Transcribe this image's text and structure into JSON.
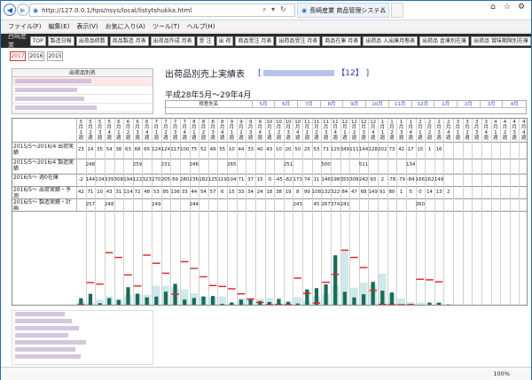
{
  "browser": {
    "url": "http://127.0.0.1/hps/nsys/local/listytshukka.html",
    "tab_title": "長崎産業 商品管理システム",
    "zoom": "100%"
  },
  "menu": [
    "ファイル(F)",
    "編集(E)",
    "表示(V)",
    "お気に入り(A)",
    "ツール(T)",
    "ヘルプ(H)"
  ],
  "app": {
    "brand": "西崎産業",
    "nav": [
      "TOP",
      "製造日報",
      "出荷品修数",
      "商品製造 月表",
      "出荷品作成 月表",
      "受 注",
      "出 荷",
      "商品受注 月表",
      "出荷品受注 月表",
      "商品在庫 月表",
      "出荷品 入出庫月態表",
      "出荷品 倉庫別在庫",
      "出荷品 賞味期限別在庫"
    ]
  },
  "years": [
    "2017",
    "2016",
    "2015"
  ],
  "left_panel": {
    "header": "出荷品別名"
  },
  "report": {
    "title": "出荷品別売上実績表",
    "bracket_open": "[",
    "product_code": "【12】",
    "bracket_close": "]",
    "period": "平成28年5月～29年4月",
    "summary_header": "得意先名",
    "months": [
      "5月",
      "6月",
      "7月",
      "8月",
      "9月",
      "10月",
      "11月",
      "12月",
      "1月",
      "2月",
      "3月",
      "4月"
    ]
  },
  "rows": [
    {
      "label": "2015/5〜2016/4 出荷実績"
    },
    {
      "label": "2015/5〜2016/4 製造実績"
    },
    {
      "label": "2016/5〜 週0在庫"
    },
    {
      "label": "2016/5〜 出荷実績・予測"
    },
    {
      "label": "2016/5〜 製造実績・計画"
    }
  ],
  "weeks": [
    "5月1週",
    "5月2週",
    "5月3週",
    "5月4週",
    "6月1週",
    "6月2週",
    "6月3週",
    "6月4週",
    "7月1週",
    "7月2週",
    "7月3週",
    "7月4週",
    "8月1週",
    "8月2週",
    "8月3週",
    "8月4週",
    "9月1週",
    "9月2週",
    "9月3週",
    "9月4週",
    "10月1週",
    "10月2週",
    "10月3週",
    "10月4週",
    "11月1週",
    "11月2週",
    "11月3週",
    "11月4週",
    "12月1週",
    "12月2週",
    "12月3週",
    "12月4週",
    "1月1週",
    "1月2週",
    "1月3週",
    "1月4週",
    "2月1週",
    "2月2週",
    "2月3週",
    "2月4週",
    "3月1週",
    "3月2週",
    "3月3週",
    "3月4週",
    "4月1週",
    "4月2週",
    "4月3週",
    "4月4週"
  ],
  "data": {
    "ship_prev": [
      "23",
      "14",
      "35",
      "54",
      "38",
      "63",
      "68",
      "65",
      "124",
      "124",
      "117",
      "100",
      "75",
      "52",
      "49",
      "55",
      "10",
      "44",
      "33",
      "40",
      "43",
      "10",
      "20",
      "50",
      "25",
      "53",
      "71",
      "125",
      "349",
      "111",
      "144",
      "128",
      "202",
      "73",
      "42",
      "17",
      "15",
      "1",
      "16",
      "",
      "",
      "",
      "",
      "",
      "",
      "",
      "",
      ""
    ],
    "prod_prev": [
      "",
      "248",
      "",
      "",
      "",
      "",
      "259",
      "",
      "",
      "231",
      "",
      "",
      "246",
      "",
      "",
      "",
      "265",
      "",
      "",
      "",
      "",
      "",
      "251",
      "",
      "",
      "",
      "500",
      "",
      "",
      "",
      "511",
      "",
      "",
      "",
      "",
      "134",
      "",
      "",
      "",
      "",
      "",
      "",
      "",
      "",
      "",
      "",
      "",
      ""
    ],
    "stock": [
      "-2",
      "144",
      "134",
      "339",
      "308",
      "194",
      "122",
      "323",
      "270",
      "205",
      "69",
      "280",
      "236",
      "182",
      "125",
      "119",
      "104",
      "71",
      "37",
      "15",
      "-5",
      "-45",
      "-82",
      "173",
      "74",
      "11",
      "146",
      "198",
      "355",
      "308",
      "242",
      "93",
      "2",
      "-78",
      "-79",
      "-84",
      "166",
      "162",
      "149",
      "",
      "",
      "",
      "",
      "",
      "",
      "",
      "",
      ""
    ],
    "ship_curr": [
      "42",
      "71",
      "10",
      "43",
      "31",
      "114",
      "72",
      "48",
      "53",
      "85",
      "136",
      "33",
      "44",
      "54",
      "57",
      "6",
      "15",
      "33",
      "34",
      "24",
      "18",
      "38",
      "19",
      "8",
      "99",
      "108",
      "132",
      "322",
      "84",
      "47",
      "68",
      "149",
      "91",
      "80",
      "1",
      "5",
      "0",
      "14",
      "13",
      "2",
      "",
      "",
      "",
      "",
      "",
      "",
      "",
      ""
    ],
    "prod_curr": [
      "",
      "257",
      "",
      "248",
      "",
      "",
      "",
      "",
      "249",
      "",
      "",
      "",
      "244",
      "",
      "",
      "",
      "",
      "",
      "",
      "",
      "",
      "",
      "",
      "243",
      "",
      "45",
      "267",
      "374",
      "241",
      "",
      "",
      "",
      "",
      "",
      "",
      "",
      "260",
      "",
      "",
      "",
      "",
      "",
      "",
      "",
      "",
      "",
      "",
      ""
    ]
  },
  "chart_data": {
    "type": "bar",
    "ylim": [
      0,
      600
    ],
    "categories_ref": "weeks",
    "series": [
      {
        "name": "出荷実績",
        "values": [
          42,
          71,
          10,
          43,
          31,
          114,
          72,
          48,
          53,
          85,
          136,
          33,
          44,
          54,
          57,
          6,
          15,
          33,
          34,
          24,
          18,
          38,
          19,
          8,
          99,
          108,
          132,
          322,
          84,
          47,
          68,
          149,
          91,
          80,
          1,
          5,
          0,
          14,
          13,
          2,
          0,
          0,
          0,
          0,
          0,
          0,
          0,
          0
        ],
        "color": "#1a6a5a"
      },
      {
        "name": "前年出荷",
        "values": [
          23,
          14,
          35,
          54,
          38,
          63,
          68,
          65,
          124,
          124,
          117,
          100,
          75,
          52,
          49,
          55,
          10,
          44,
          33,
          40,
          43,
          10,
          20,
          50,
          25,
          53,
          71,
          125,
          349,
          111,
          144,
          128,
          202,
          73,
          42,
          17,
          15,
          1,
          16,
          0,
          0,
          0,
          0,
          0,
          0,
          0,
          0,
          0
        ],
        "color": "#cfe9ea"
      },
      {
        "name": "在庫",
        "values": [
          -2,
          144,
          134,
          339,
          308,
          194,
          122,
          323,
          270,
          205,
          69,
          280,
          236,
          182,
          125,
          119,
          104,
          71,
          37,
          15,
          -5,
          -45,
          -82,
          173,
          74,
          11,
          146,
          198,
          355,
          308,
          242,
          93,
          2,
          -78,
          -79,
          -84,
          166,
          162,
          149,
          0,
          0,
          0,
          0,
          0,
          0,
          0,
          0,
          0
        ],
        "color": "#d22"
      }
    ]
  },
  "bottom_panel": {
    "rows": [
      "",
      "",
      "",
      "",
      "",
      "",
      ""
    ]
  }
}
